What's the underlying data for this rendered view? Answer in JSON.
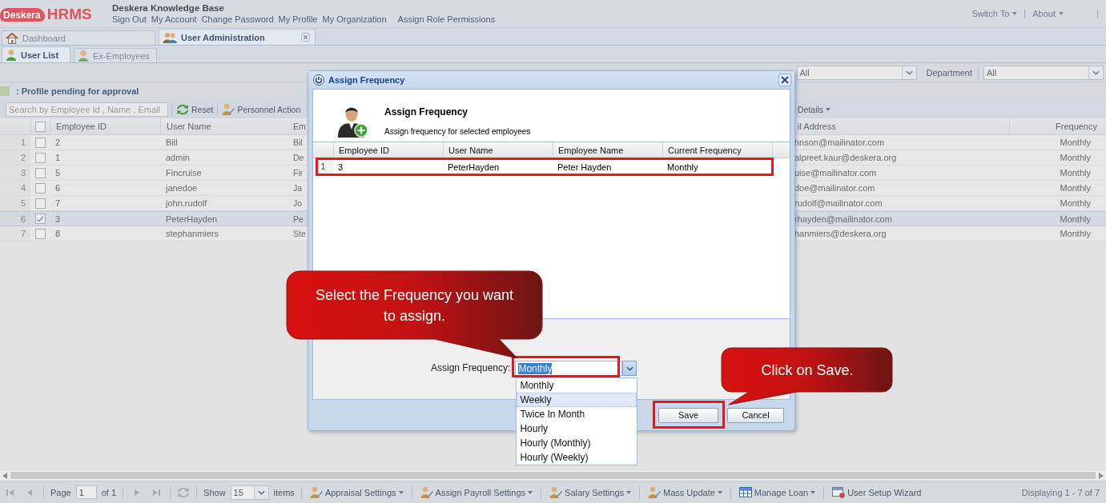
{
  "header": {
    "logo_mark": "Deskera",
    "logo_text": "HRMS",
    "title": "Deskera Knowledge Base",
    "links": [
      "Sign Out",
      "My Account",
      "Change Password",
      "My Profile",
      "My Organization",
      "Assign Role Permissions"
    ],
    "menus": [
      "Switch To",
      "About"
    ]
  },
  "main_tabs": [
    {
      "label": "Dashboard",
      "selected": false,
      "closable": false
    },
    {
      "label": "User Administration",
      "selected": true,
      "closable": true
    }
  ],
  "sub_tabs": [
    {
      "label": "User List",
      "selected": true
    },
    {
      "label": "Ex-Employees",
      "selected": false
    }
  ],
  "filters": [
    {
      "value": "All"
    },
    {
      "label": "Department",
      "value": "All"
    }
  ],
  "legend": {
    "text": ": Profile pending for approval"
  },
  "toolbar": {
    "search": {
      "placeholder": "Search by Employee Id , Name , Email"
    },
    "buttons": [
      {
        "label": "Reset",
        "kind": "reset"
      },
      {
        "label": "Personnel Action",
        "kind": "actions"
      }
    ],
    "right_buttons": [
      {
        "label": "Details",
        "kind": "menu"
      }
    ]
  },
  "grid": {
    "select_all": {
      "checked": false
    },
    "columns": [
      "Employee ID",
      "User Name",
      "Em",
      "il Address",
      "Frequency"
    ],
    "rows": [
      {
        "number": "1",
        "checked": false,
        "selected": false,
        "cells": [
          "2",
          "Bill",
          "Bil",
          "hnson@mailinator.com",
          "Monthly"
        ]
      },
      {
        "number": "2",
        "checked": false,
        "selected": false,
        "cells": [
          "1",
          "admin",
          "De",
          "alpreet.kaur@deskera.org",
          "Monthly"
        ]
      },
      {
        "number": "3",
        "checked": false,
        "selected": false,
        "cells": [
          "5",
          "Fincruise",
          "Fir",
          "uise@mailinator.com",
          "Monthly"
        ]
      },
      {
        "number": "4",
        "checked": false,
        "selected": false,
        "cells": [
          "6",
          "janedoe",
          "Ja",
          "doe@mailinator.com",
          "Monthly"
        ]
      },
      {
        "number": "5",
        "checked": false,
        "selected": false,
        "cells": [
          "7",
          "john.rudolf",
          "Jo",
          "rudolf@mailinator.com",
          "Monthly"
        ]
      },
      {
        "number": "6",
        "checked": true,
        "selected": true,
        "cells": [
          "3",
          "PeterHayden",
          "Pe",
          "rhayden@mailinator.com",
          "Monthly"
        ]
      },
      {
        "number": "7",
        "checked": false,
        "selected": false,
        "cells": [
          "8",
          "stephanmiers",
          "Ste",
          "hanmiers@deskera.org",
          "Monthly"
        ]
      }
    ]
  },
  "pager": {
    "nav_disabled": true,
    "page_label": "Page",
    "page": "1",
    "of": "of 1",
    "show_label": "Show",
    "page_size": "15",
    "items_label": "items",
    "menus": [
      {
        "label": "Appraisal Settings",
        "kind": "settings"
      },
      {
        "label": "Assign Payroll Settings",
        "kind": "settings"
      },
      {
        "label": "Salary Settings",
        "kind": "settings"
      },
      {
        "label": "Mass Update",
        "kind": "settings"
      },
      {
        "label": "Manage Loan",
        "kind": "loan"
      },
      {
        "label": "User Setup Wizard",
        "kind": "wizard"
      }
    ],
    "status": "Displaying 1 - 7 of 7"
  },
  "dialog": {
    "title": "Assign Frequency",
    "heading": "Assign Frequency",
    "subheading": "Assign frequency for selected employees",
    "columns": [
      "Employee ID",
      "User Name",
      "Employee Name",
      "Current Frequency"
    ],
    "rows": [
      {
        "number": "1",
        "highlighted": true,
        "cells": [
          "3",
          "PeterHayden",
          "Peter Hayden",
          "Monthly"
        ]
      }
    ],
    "field": {
      "label": "Assign Frequency:",
      "value": "Monthly",
      "text_selected": true,
      "expanded": true,
      "highlighted": true
    },
    "options": [
      {
        "label": "Monthly",
        "selected": false
      },
      {
        "label": "Weekly",
        "selected": true
      },
      {
        "label": "Twice In Month",
        "selected": false
      },
      {
        "label": "Hourly",
        "selected": false
      },
      {
        "label": "Hourly (Monthly)",
        "selected": false
      },
      {
        "label": "Hourly (Weekly)",
        "selected": false
      }
    ],
    "buttons": [
      {
        "label": "Save",
        "highlighted": true
      },
      {
        "label": "Cancel",
        "highlighted": false
      }
    ]
  },
  "callouts": [
    {
      "text": "Select the Frequency you want to assign."
    },
    {
      "text": "Click on Save."
    }
  ]
}
